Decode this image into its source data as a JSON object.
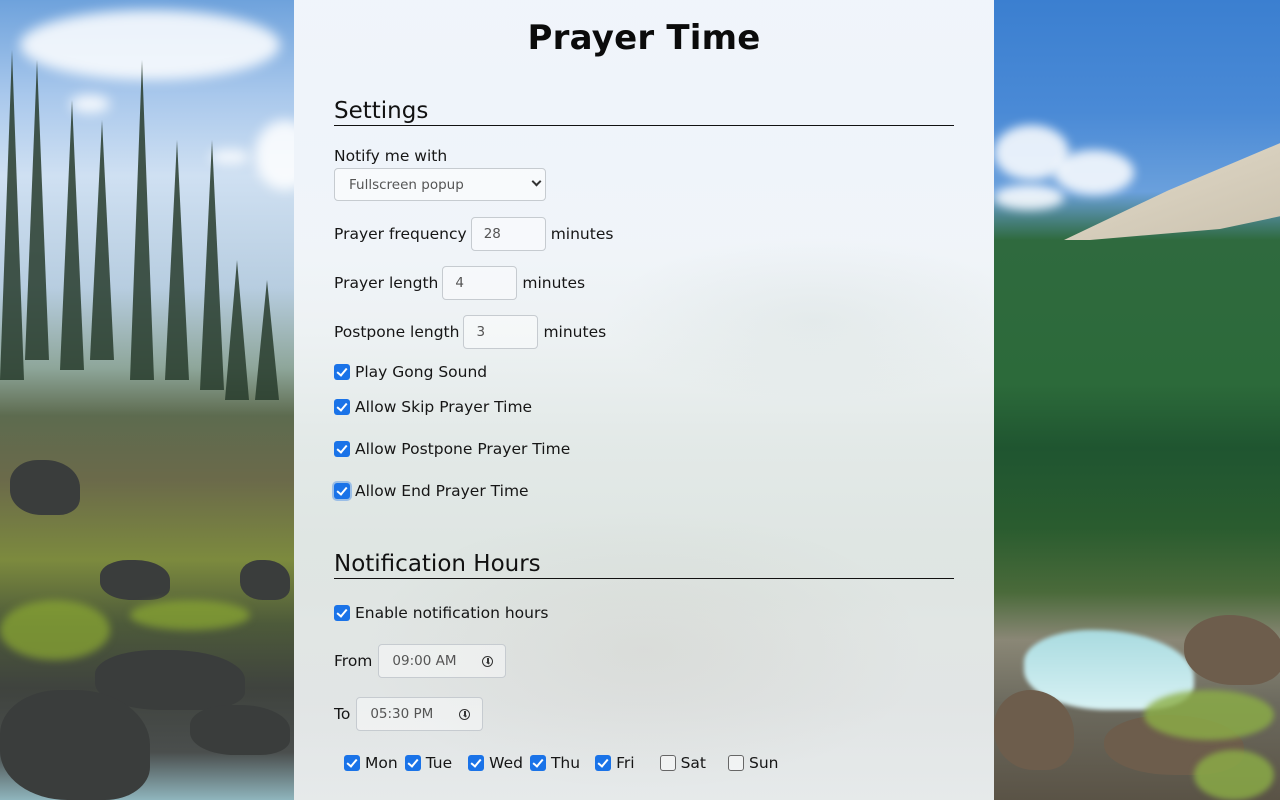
{
  "page": {
    "title": "Prayer Time"
  },
  "settings": {
    "heading": "Settings",
    "notify": {
      "label": "Notify me with",
      "selected": "Fullscreen popup"
    },
    "frequency": {
      "label": "Prayer frequency",
      "value": "28",
      "unit": "minutes"
    },
    "length": {
      "label": "Prayer length",
      "value": "4",
      "unit": "minutes"
    },
    "postpone": {
      "label": "Postpone length",
      "value": "3",
      "unit": "minutes"
    },
    "checkboxes": [
      {
        "label": "Play Gong Sound",
        "checked": true
      },
      {
        "label": "Allow Skip Prayer Time",
        "checked": true
      },
      {
        "label": "Allow Postpone Prayer Time",
        "checked": true
      },
      {
        "label": "Allow End Prayer Time",
        "checked": true
      }
    ]
  },
  "hours": {
    "heading": "Notification Hours",
    "enable": {
      "label": "Enable notification hours",
      "checked": true
    },
    "from": {
      "label": "From",
      "value": "09:00 AM"
    },
    "to": {
      "label": "To",
      "value": "05:30 PM"
    },
    "days": [
      {
        "label": "Mon",
        "checked": true
      },
      {
        "label": "Tue",
        "checked": true
      },
      {
        "label": "Wed",
        "checked": true
      },
      {
        "label": "Thu",
        "checked": true
      },
      {
        "label": "Fri",
        "checked": true
      },
      {
        "label": "Sat",
        "checked": false
      },
      {
        "label": "Sun",
        "checked": false
      }
    ]
  },
  "colors": {
    "checkbox_accent": "#1a73e8",
    "text": "#111111"
  }
}
